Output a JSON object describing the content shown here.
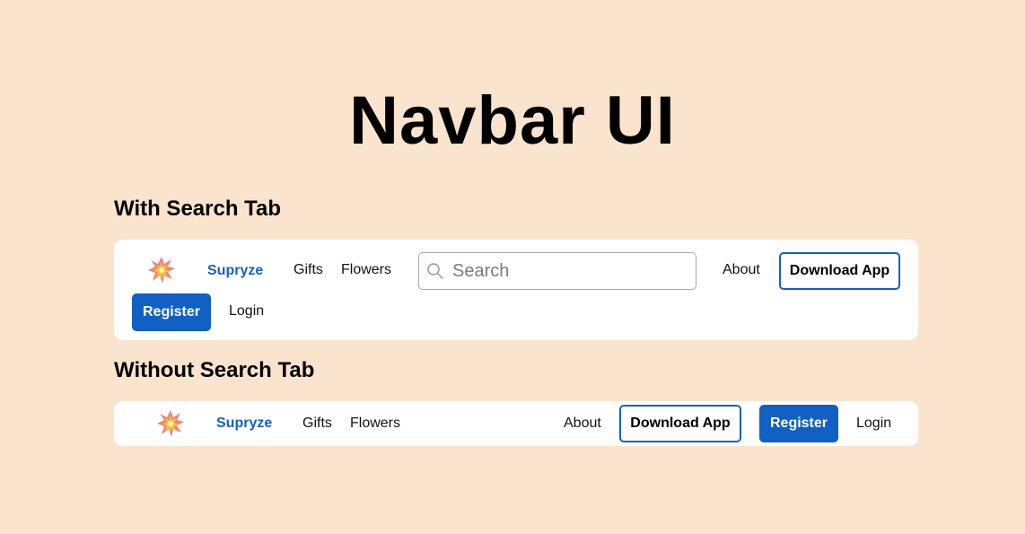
{
  "page": {
    "title": "Navbar UI"
  },
  "sections": [
    {
      "title": "With Search Tab"
    },
    {
      "title": "Without Search Tab"
    }
  ],
  "navbar_with_search": {
    "logo_icon": "explosion-icon",
    "brand": "Supryze",
    "links": [
      "Gifts",
      "Flowers"
    ],
    "search": {
      "placeholder": "Search",
      "value": "",
      "icon": "search-icon"
    },
    "about": "About",
    "download_label": "Download App",
    "register_label": "Register",
    "login_label": "Login"
  },
  "navbar_without_search": {
    "logo_icon": "explosion-icon",
    "brand": "Supryze",
    "links": [
      "Gifts",
      "Flowers"
    ],
    "about": "About",
    "download_label": "Download App",
    "register_label": "Register",
    "login_label": "Login"
  },
  "colors": {
    "background": "#fbe4cd",
    "brand": "#1460c8",
    "primary": "#1160c4",
    "surface": "#ffffff"
  }
}
